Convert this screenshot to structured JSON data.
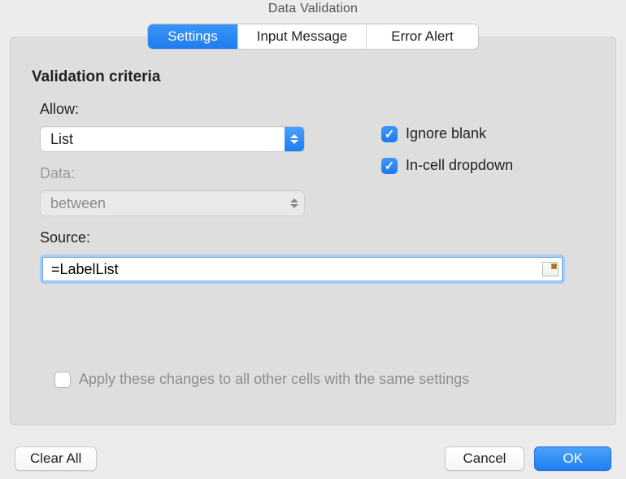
{
  "window": {
    "title": "Data Validation"
  },
  "tabs": {
    "settings": "Settings",
    "input_message": "Input Message",
    "error_alert": "Error Alert",
    "active": "settings"
  },
  "section": {
    "title": "Validation criteria"
  },
  "allow": {
    "label": "Allow:",
    "value": "List"
  },
  "data": {
    "label": "Data:",
    "value": "between",
    "enabled": false
  },
  "source": {
    "label": "Source:",
    "value": "=LabelList"
  },
  "options": {
    "ignore_blank": {
      "label": "Ignore blank",
      "checked": true
    },
    "in_cell_dropdown": {
      "label": "In-cell dropdown",
      "checked": true
    }
  },
  "apply_all": {
    "label": "Apply these changes to all other cells with the same settings",
    "checked": false,
    "enabled": false
  },
  "buttons": {
    "clear_all": "Clear All",
    "cancel": "Cancel",
    "ok": "OK"
  }
}
